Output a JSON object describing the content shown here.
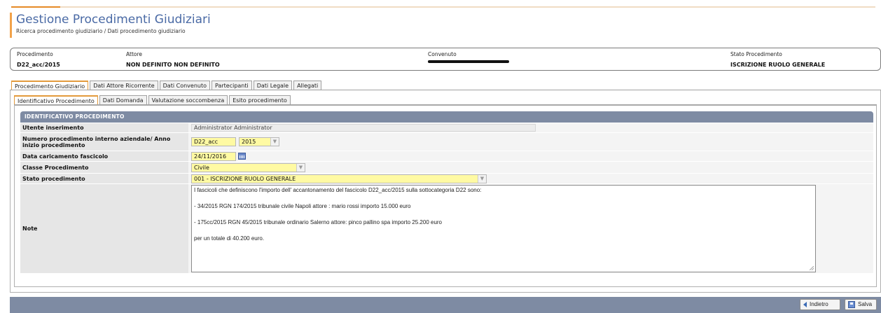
{
  "header": {
    "title": "Gestione Procedimenti Giudiziari",
    "breadcrumb": "Ricerca procedimento giudiziario / Dati procedimento giudiziario"
  },
  "summary": {
    "procedimento_label": "Procedimento",
    "procedimento_value": "D22_acc/2015",
    "attore_label": "Attore",
    "attore_value": "NON DEFINITO NON DEFINITO",
    "convenuto_label": "Convenuto",
    "stato_label": "Stato Procedimento",
    "stato_value": "ISCRIZIONE RUOLO GENERALE"
  },
  "main_tabs": [
    {
      "label": "Procedimento Giudiziario",
      "active": true
    },
    {
      "label": "Dati Attore Ricorrente",
      "active": false
    },
    {
      "label": "Dati Convenuto",
      "active": false
    },
    {
      "label": "Partecipanti",
      "active": false
    },
    {
      "label": "Dati Legale",
      "active": false
    },
    {
      "label": "Allegati",
      "active": false
    }
  ],
  "sub_tabs": [
    {
      "label": "Identificativo Procedimento",
      "active": true
    },
    {
      "label": "Dati Domanda",
      "active": false
    },
    {
      "label": "Valutazione soccombenza",
      "active": false
    },
    {
      "label": "Esito procedimento",
      "active": false
    }
  ],
  "section": {
    "title": "IDENTIFICATIVO PROCEDIMENTO"
  },
  "form": {
    "utente_label": "Utente inserimento",
    "utente_value": "Administrator Administrator",
    "numero_label": "Numero procedimento interno aziendale/ Anno inizio procedimento",
    "numero_value": "D22_acc",
    "anno_value": "2015",
    "data_label": "Data caricamento fascicolo",
    "data_value": "24/11/2016",
    "classe_label": "Classe Procedimento",
    "classe_value": "Civile",
    "stato_label": "Stato procedimento",
    "stato_value": "001 - ISCRIZIONE RUOLO GENERALE",
    "note_label": "Note",
    "note_lines": [
      "I fascicoli che definiscono l'importo dell' accantonamento del fascicolo D22_acc/2015 sulla sottocategoria D22 sono:",
      "- 34/2015  RGN 174/2015  tribunale civile Napoli  attore : mario rossi importo 15.000 euro",
      "- 175cc/2015 RGN 45/2015 tribunale ordinario Salerno attore: pinco pallino spa importo 25.200 euro",
      "per un totale di 40.200 euro."
    ]
  },
  "footer": {
    "back_label": "Indietro",
    "save_label": "Salva"
  },
  "colors": {
    "title": "#4a6aa5",
    "accent": "#e58a26",
    "section_bar": "#7e8ba3",
    "input_highlight": "#fffaa3"
  }
}
